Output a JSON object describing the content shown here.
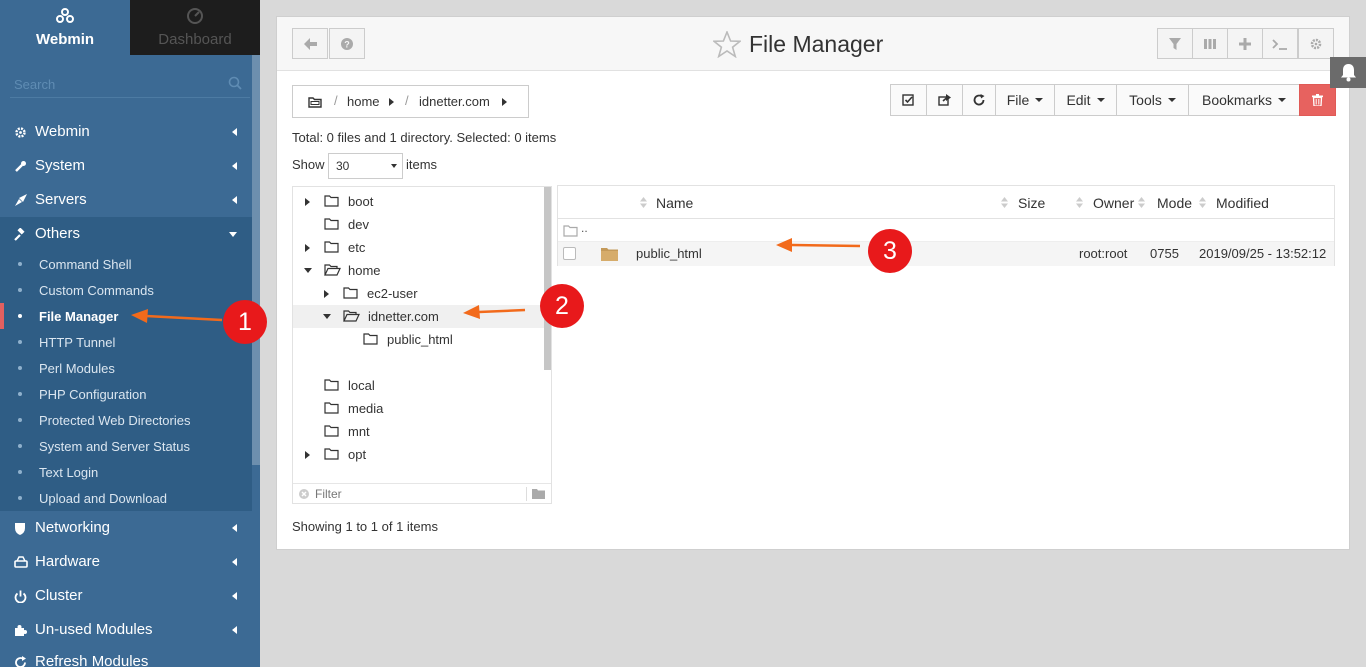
{
  "sidebar": {
    "tabs": [
      {
        "label": "Webmin",
        "icon": "webmin-logo-icon"
      },
      {
        "label": "Dashboard",
        "icon": "dashboard-gauge-icon"
      }
    ],
    "search_placeholder": "Search",
    "groups": [
      {
        "label": "Webmin",
        "icon": "gear-icon"
      },
      {
        "label": "System",
        "icon": "wrench-icon"
      },
      {
        "label": "Servers",
        "icon": "rocket-icon"
      },
      {
        "label": "Others",
        "icon": "gavel-icon"
      },
      {
        "label": "Networking",
        "icon": "shield-icon"
      },
      {
        "label": "Hardware",
        "icon": "hard-drive-icon"
      },
      {
        "label": "Cluster",
        "icon": "power-icon"
      },
      {
        "label": "Un-used Modules",
        "icon": "puzzle-icon"
      },
      {
        "label": "Refresh Modules",
        "icon": "refresh-icon"
      }
    ],
    "others_items": [
      "Command Shell",
      "Custom Commands",
      "File Manager",
      "HTTP Tunnel",
      "Perl Modules",
      "PHP Configuration",
      "Protected Web Directories",
      "System and Server Status",
      "Text Login",
      "Upload and Download"
    ]
  },
  "header": {
    "title": "File Manager",
    "left_buttons": [
      "back-arrow-icon",
      "help-icon"
    ],
    "right_buttons": [
      "filter-icon",
      "columns-icon",
      "plus-icon",
      "terminal-icon",
      "gear-icon"
    ]
  },
  "breadcrumb": {
    "segments": [
      "home",
      "idnetter.com"
    ]
  },
  "toolbar": {
    "icon_buttons": [
      "select-all-icon",
      "share-icon",
      "refresh-icon"
    ],
    "menus": [
      "File",
      "Edit",
      "Tools",
      "Bookmarks"
    ],
    "delete_icon": "trash-icon"
  },
  "summary": "Total: 0 files and 1 directory. Selected: 0 items",
  "show": {
    "label": "Show",
    "value": "30",
    "suffix": "items"
  },
  "tree": {
    "nodes": [
      {
        "label": "boot",
        "expandable": true,
        "expanded": false
      },
      {
        "label": "dev",
        "expandable": false,
        "expanded": false
      },
      {
        "label": "etc",
        "expandable": true,
        "expanded": false
      },
      {
        "label": "home",
        "expandable": true,
        "expanded": true
      },
      {
        "label": "ec2-user",
        "expandable": true,
        "expanded": false
      },
      {
        "label": "idnetter.com",
        "expandable": true,
        "expanded": true
      },
      {
        "label": "public_html",
        "expandable": false,
        "expanded": false
      },
      {
        "label": "local",
        "expandable": false,
        "expanded": false
      },
      {
        "label": "media",
        "expandable": false,
        "expanded": false
      },
      {
        "label": "mnt",
        "expandable": false,
        "expanded": false
      },
      {
        "label": "opt",
        "expandable": true,
        "expanded": false
      }
    ],
    "filter_placeholder": "Filter"
  },
  "table": {
    "columns": [
      "Name",
      "Size",
      "Owner",
      "Mode",
      "Modified"
    ],
    "parent_dir_label": "..",
    "rows": [
      {
        "name": "public_html",
        "size": "",
        "owner": "root:root",
        "mode": "0755",
        "modified": "2019/09/25 - 13:52:12"
      }
    ]
  },
  "footer": "Showing 1 to 1 of 1 items",
  "annotations": [
    "1",
    "2",
    "3"
  ],
  "colors": {
    "sidebar_bg": "#3c6a94",
    "sidebar_active": "#2f5d85",
    "annotation_red": "#e8191b",
    "arrow_orange": "#f26a1b",
    "delete_red": "#e7625f"
  }
}
